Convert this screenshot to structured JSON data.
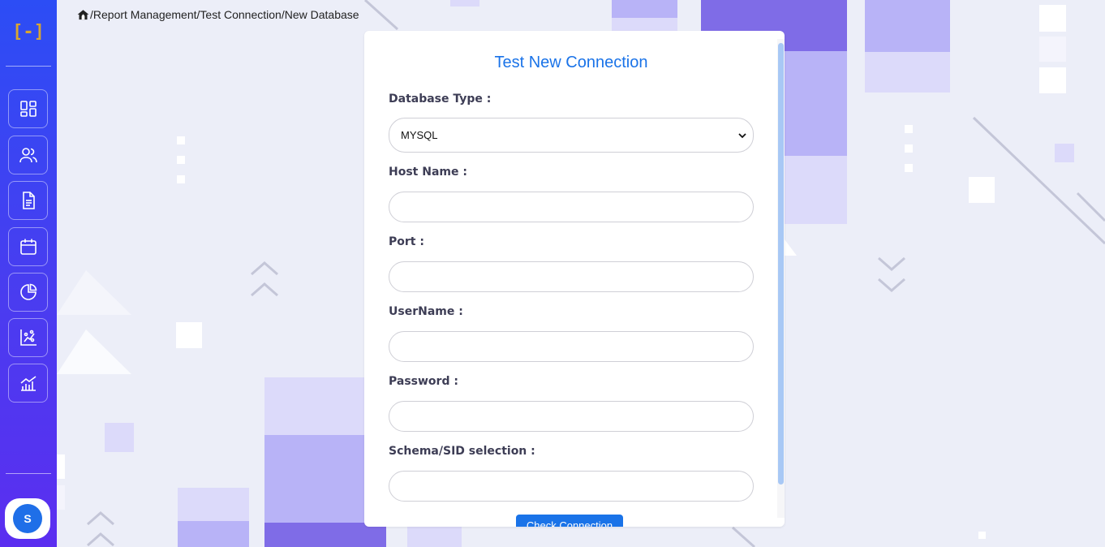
{
  "app": {
    "logo_text": "[-]"
  },
  "sidebar": {
    "items": [
      {
        "name": "dashboard",
        "icon": "dashboard-grid-icon"
      },
      {
        "name": "users",
        "icon": "users-icon"
      },
      {
        "name": "reports",
        "icon": "document-icon"
      },
      {
        "name": "calendar",
        "icon": "calendar-icon"
      },
      {
        "name": "analytics",
        "icon": "pie-chart-icon"
      },
      {
        "name": "scatter",
        "icon": "scatter-chart-icon"
      },
      {
        "name": "trends",
        "icon": "bar-line-chart-icon"
      }
    ],
    "user_initial": "S"
  },
  "breadcrumb": {
    "home_icon": "home-icon",
    "separator": "/",
    "items": [
      "Report Management",
      "Test Connection",
      "New Database"
    ]
  },
  "form": {
    "title": "Test New Connection",
    "database_type": {
      "label": "Database Type :",
      "value": "MYSQL"
    },
    "host_name": {
      "label": "Host Name :",
      "value": ""
    },
    "port": {
      "label": "Port :",
      "value": ""
    },
    "username": {
      "label": "UserName :",
      "value": ""
    },
    "password": {
      "label": "Password :",
      "value": ""
    },
    "schema": {
      "label": "Schema/SID selection :",
      "value": ""
    },
    "submit_label": "Check Connection"
  },
  "colors": {
    "sidebar_top": "#2c4df5",
    "sidebar_bottom": "#5b2ef0",
    "accent": "#1a73e8",
    "logo": "#d9a630",
    "background": "#eceef8"
  }
}
